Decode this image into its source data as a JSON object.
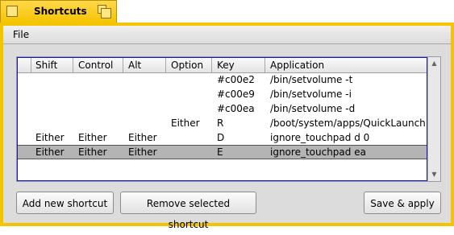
{
  "window": {
    "title": "Shortcuts"
  },
  "menu": {
    "file": "File"
  },
  "columns": [
    "Shift",
    "Control",
    "Alt",
    "Option",
    "Key",
    "Application"
  ],
  "rows": [
    {
      "shift": "",
      "control": "",
      "alt": "",
      "option": "",
      "key": "#c00e2",
      "application": "/bin/setvolume -t"
    },
    {
      "shift": "",
      "control": "",
      "alt": "",
      "option": "",
      "key": "#c00e9",
      "application": "/bin/setvolume -i"
    },
    {
      "shift": "",
      "control": "",
      "alt": "",
      "option": "",
      "key": "#c00ea",
      "application": "/bin/setvolume -d"
    },
    {
      "shift": "",
      "control": "",
      "alt": "",
      "option": "Either",
      "key": "R",
      "application": "/boot/system/apps/QuickLaunch"
    },
    {
      "shift": "Either",
      "control": "Either",
      "alt": "Either",
      "option": "",
      "key": "D",
      "application": "ignore_touchpad d 0"
    },
    {
      "shift": "Either",
      "control": "Either",
      "alt": "Either",
      "option": "",
      "key": "E",
      "application": "ignore_touchpad ea"
    }
  ],
  "selected_row": 5,
  "buttons": {
    "add": "Add new shortcut",
    "remove": "Remove selected shortcut",
    "save": "Save & apply"
  },
  "colors": {
    "tab": "#f5c400",
    "selection": "#b4b4b4",
    "list_focus": "#1a1aa8"
  }
}
